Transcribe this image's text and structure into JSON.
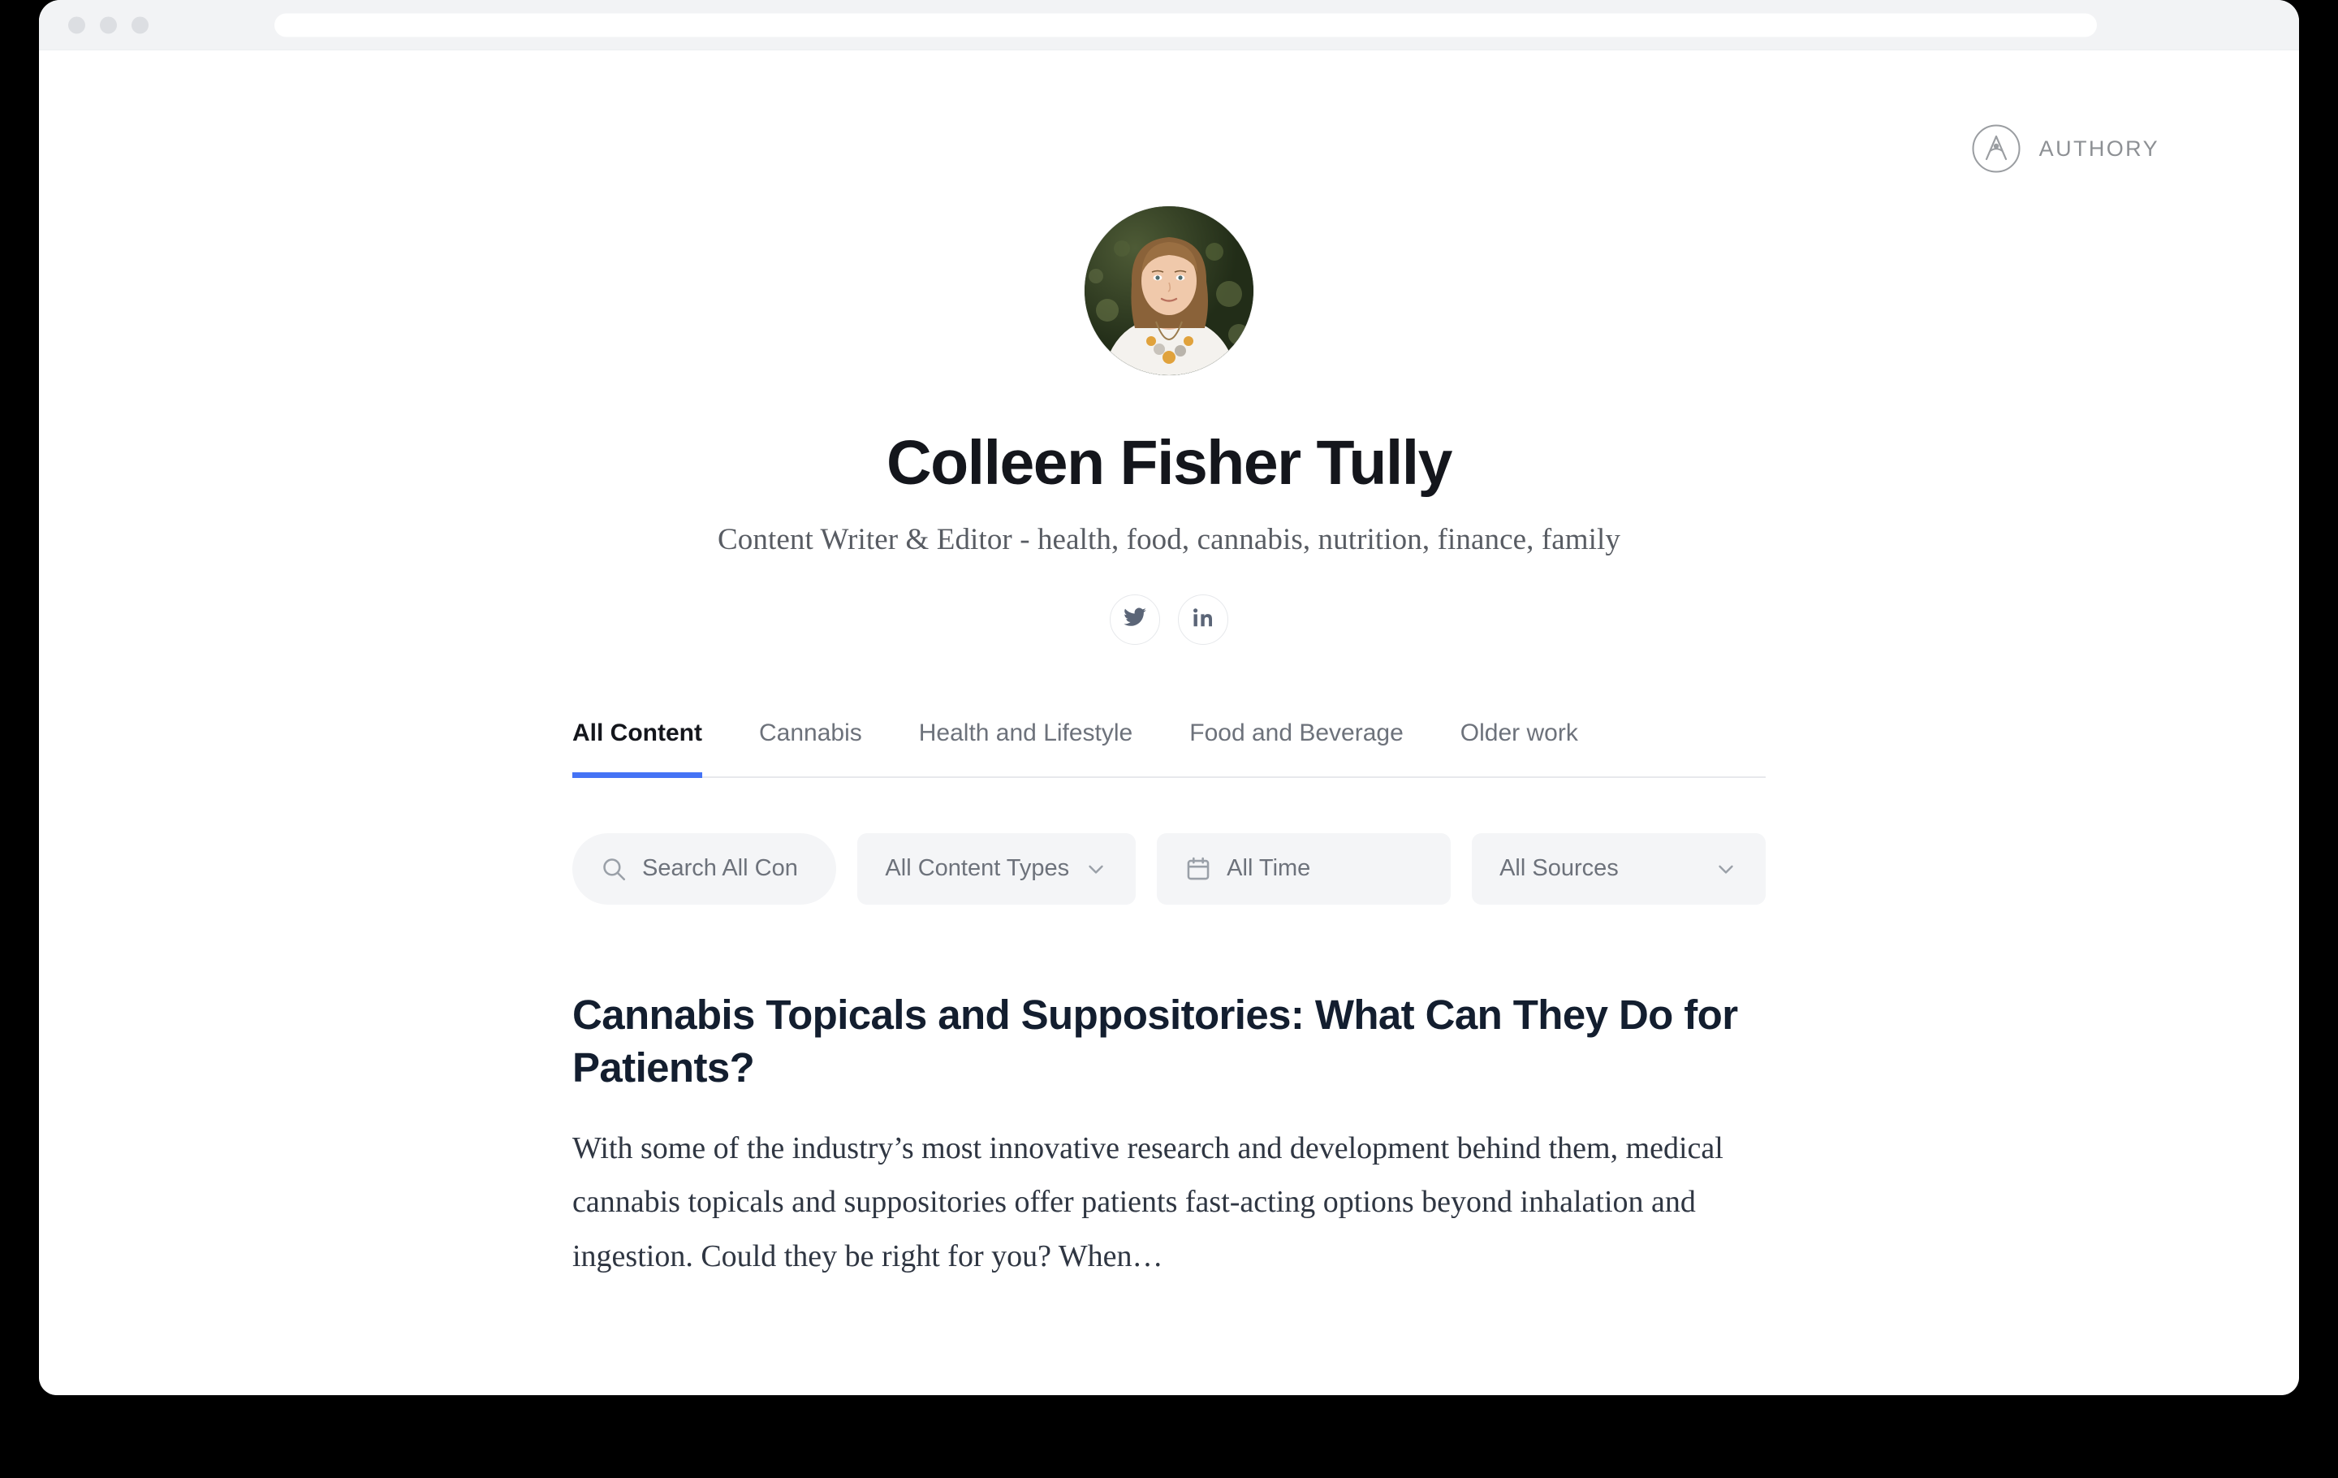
{
  "browser": {
    "traffic_lights": [
      "close",
      "minimize",
      "maximize"
    ],
    "address_value": ""
  },
  "brand": {
    "name": "AUTHORY",
    "logo_icon": "authory-compass-a-icon"
  },
  "profile": {
    "avatar_alt": "Portrait of Colleen Fisher Tully",
    "name": "Colleen Fisher Tully",
    "tagline": "Content Writer & Editor - health, food, cannabis, nutrition, finance, family",
    "socials": [
      {
        "icon": "twitter-icon",
        "label": "Twitter"
      },
      {
        "icon": "linkedin-icon",
        "label": "LinkedIn"
      }
    ]
  },
  "tabs": [
    {
      "label": "All Content",
      "active": true
    },
    {
      "label": "Cannabis",
      "active": false
    },
    {
      "label": "Health and Lifestyle",
      "active": false
    },
    {
      "label": "Food and Beverage",
      "active": false
    },
    {
      "label": "Older work",
      "active": false
    }
  ],
  "filters": {
    "search": {
      "icon": "search-icon",
      "placeholder": "Search All Con",
      "value": ""
    },
    "content_type": {
      "label": "All Content Types",
      "chevron": "chevron-down-icon"
    },
    "time": {
      "icon": "calendar-icon",
      "label": "All Time"
    },
    "sources": {
      "label": "All Sources",
      "chevron": "chevron-down-icon"
    }
  },
  "articles": [
    {
      "title": "Cannabis Topicals and Suppositories: What Can They Do for Patients?",
      "excerpt": "With some of the industry’s most innovative research and development behind them, medical cannabis topicals and suppositories offer patients fast-acting options beyond inhalation and ingestion. Could they be right for you? When…"
    }
  ],
  "colors": {
    "accent_blue": "#4573f5",
    "heading_dark": "#131e2f",
    "muted_gray": "#6d727b",
    "chrome_gray": "#f2f3f5",
    "field_gray": "#f4f5f7",
    "page_background": "#000000"
  }
}
